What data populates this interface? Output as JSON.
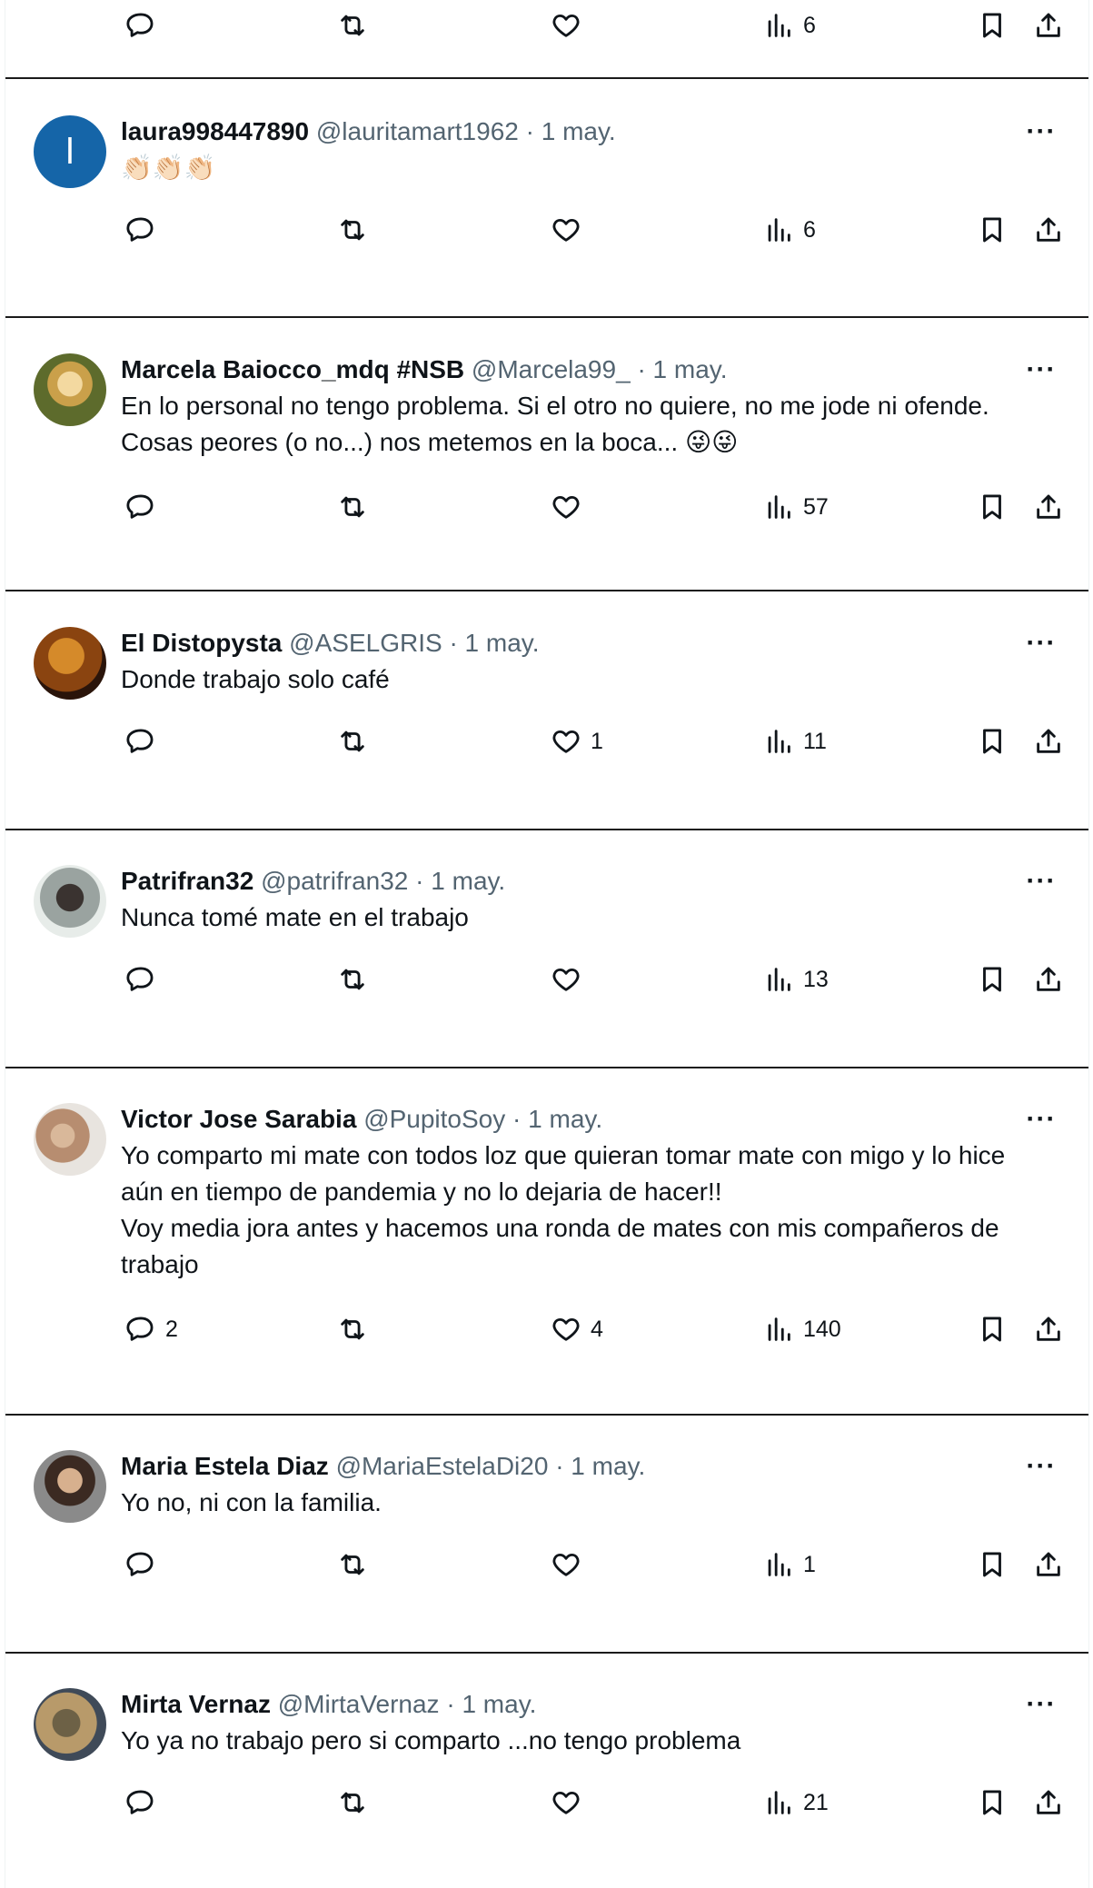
{
  "top_actions": {
    "reply_count": "",
    "retweet_count": "",
    "like_count": "",
    "views_count": "6"
  },
  "tweets": [
    {
      "name": "laura998447890",
      "handle": "@lauritamart1962",
      "sep": "·",
      "date": "1 may.",
      "avatar_initial": "l",
      "text": "👏🏻👏🏻👏🏻",
      "reply_count": "",
      "retweet_count": "",
      "like_count": "",
      "views_count": "6"
    },
    {
      "name": "Marcela Baiocco_mdq #NSB",
      "handle": "@Marcela99_",
      "sep": "·",
      "date": "1 may.",
      "avatar_initial": "",
      "text": "En lo personal no tengo problema. Si el otro no quiere, no me jode ni ofende. Cosas peores (o no...) nos metemos en la boca... 😜😜",
      "reply_count": "",
      "retweet_count": "",
      "like_count": "",
      "views_count": "57"
    },
    {
      "name": "El Distopysta",
      "handle": "@ASELGRIS",
      "sep": "·",
      "date": "1 may.",
      "avatar_initial": "",
      "text": "Donde trabajo solo café",
      "reply_count": "",
      "retweet_count": "",
      "like_count": "1",
      "views_count": "11"
    },
    {
      "name": "Patrifran32",
      "handle": "@patrifran32",
      "sep": "·",
      "date": "1 may.",
      "avatar_initial": "",
      "text": "Nunca tomé mate en el trabajo",
      "reply_count": "",
      "retweet_count": "",
      "like_count": "",
      "views_count": "13"
    },
    {
      "name": "Victor Jose Sarabia",
      "handle": "@PupitoSoy",
      "sep": "·",
      "date": "1 may.",
      "avatar_initial": "",
      "text": "Yo comparto mi mate con todos loz que quieran tomar mate con migo y lo hice aún en tiempo de pandemia y no lo dejaria de hacer!!\nVoy media jora antes y hacemos una ronda de mates con mis compañeros de trabajo",
      "reply_count": "2",
      "retweet_count": "",
      "like_count": "4",
      "views_count": "140"
    },
    {
      "name": "Maria Estela Diaz",
      "handle": "@MariaEstelaDi20",
      "sep": "·",
      "date": "1 may.",
      "avatar_initial": "",
      "text": "Yo no, ni con la familia.",
      "reply_count": "",
      "retweet_count": "",
      "like_count": "",
      "views_count": "1"
    },
    {
      "name": "Mirta Vernaz",
      "handle": "@MirtaVernaz",
      "sep": "·",
      "date": "1 may.",
      "avatar_initial": "",
      "text": "Yo ya no trabajo pero si comparto ...no tengo problema",
      "reply_count": "",
      "retweet_count": "",
      "like_count": "",
      "views_count": "21"
    }
  ],
  "more_glyph": "···"
}
